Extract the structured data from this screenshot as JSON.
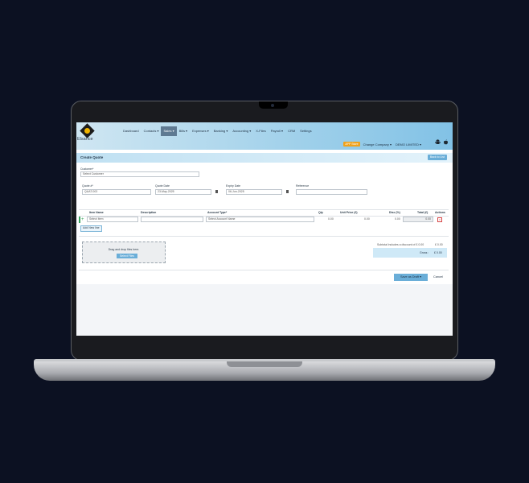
{
  "app": {
    "logo_text": "Elsance"
  },
  "nav": {
    "items": [
      "Dashboard",
      "Contacts ▾",
      "Sales ▾",
      "Bills ▾",
      "Expenses ▾",
      "Banking ▾",
      "Accounting ▾",
      "X-Files",
      "Payroll ▾",
      "CRM",
      "Settings"
    ],
    "active_index": 2
  },
  "rightnav": {
    "app_store": "APP Store",
    "change_company": "Change Company ▾",
    "company": "DEMO LIMITED ▾"
  },
  "page": {
    "title": "Create Quote",
    "back_label": "Back to List"
  },
  "form": {
    "customer_label": "Customer*",
    "customer_value": "Select Customer",
    "quote_no_label": "Quote #*",
    "quote_no_value": "QUAT-002",
    "quote_date_label": "Quote Date",
    "quote_date_value": "23-May-2025",
    "expiry_date_label": "Expiry Date",
    "expiry_date_value": "06-Jun-2025",
    "reference_label": "Reference",
    "reference_value": ""
  },
  "table": {
    "headers": [
      "Item Name",
      "Description",
      "Account Type*",
      "Qty",
      "Unit Price (£)",
      "Disc (%)",
      "Total (£)",
      "Actions"
    ],
    "row": {
      "item": "Select Item",
      "description": "",
      "account": "Select Account Name",
      "qty": "0.00",
      "unit_price": "0.00",
      "disc": "0.00",
      "total": "0.00"
    },
    "add_line": "Add New line"
  },
  "upload": {
    "text": "Drag and drop files here.",
    "button": "Select Files"
  },
  "totals": {
    "subtotal_label": "Subtotal includes a discount of £ 0.00",
    "subtotal_value": "£ 0.00",
    "gross_label": "Gross :",
    "gross_value": "£ 0.00"
  },
  "actions": {
    "save": "Save as Draft",
    "cancel": "Cancel"
  },
  "colors": {
    "accent": "#6aaed8",
    "app_store": "#f0a21b",
    "delete": "#d64545",
    "row_marker": "#3aa35c"
  }
}
